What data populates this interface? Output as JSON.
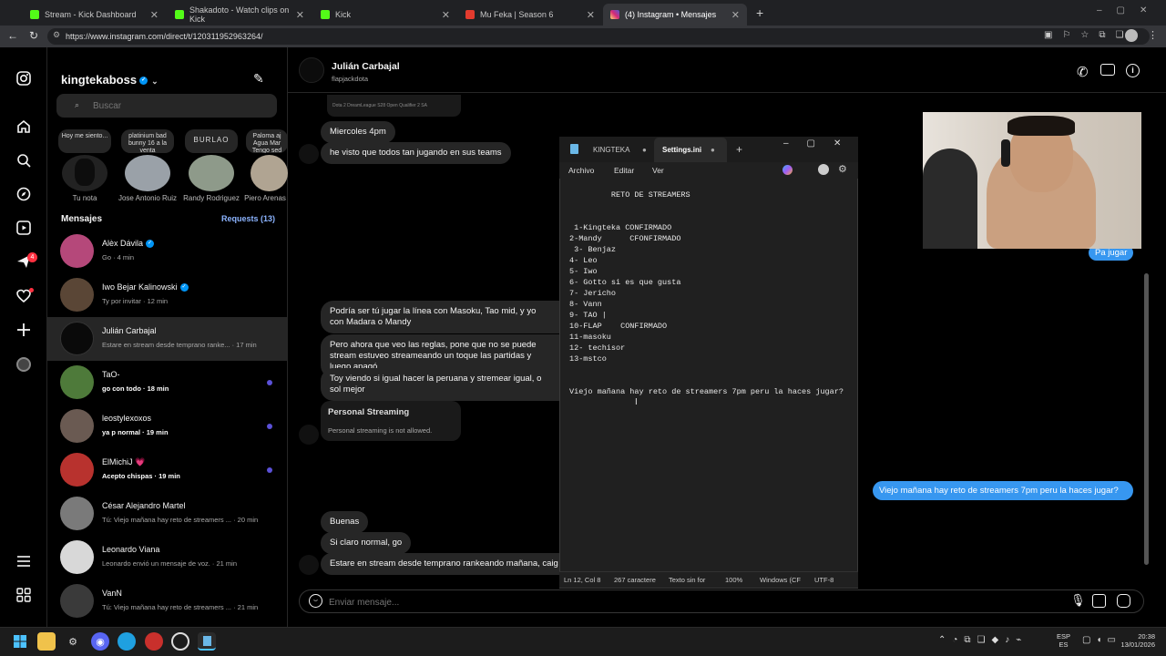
{
  "browser": {
    "tabs": [
      {
        "title": "Stream - Kick Dashboard",
        "color": "#53fc18",
        "active": false
      },
      {
        "title": "Shakadoto - Watch clips on Kick",
        "color": "#53fc18",
        "active": false
      },
      {
        "title": "Kick",
        "color": "#53fc18",
        "active": false
      },
      {
        "title": "Mu Feka | Season 6",
        "color": "#e33b2e",
        "active": false
      },
      {
        "title": "(4) Instagram • Mensajes",
        "color": "#e1306c",
        "active": true
      }
    ],
    "new_tab": "+",
    "url": "https://www.instagram.com/direct/t/120311952963264/"
  },
  "sidebar": {
    "icons": [
      "instagram-icon",
      "home-icon",
      "search-icon",
      "explore-icon",
      "reels-icon",
      "messages-icon",
      "notifications-icon",
      "create-icon",
      "profile-icon",
      "menu-icon",
      "apps-icon"
    ],
    "messages_badge": "4"
  },
  "inbox": {
    "username": "kingtekaboss",
    "search_placeholder": "Buscar",
    "notes": [
      {
        "bubble": "Hoy me siento...",
        "name": "Tu nota"
      },
      {
        "bubble": "platinium bad bunny 16 a la venta",
        "name": "Jose Antonio Ruiz"
      },
      {
        "bubble": "BURLAO",
        "name": "Randy Rodriguez"
      },
      {
        "bubble": "Paloma aj Agua Mar Tengo sed cs",
        "name": "Piero Arenas"
      }
    ],
    "messages_label": "Mensajes",
    "requests_label": "Requests (13)",
    "conversations": [
      {
        "name": "Alèx Dávila",
        "preview": "Go · 4 min",
        "verified": true,
        "unread": false,
        "bold": false,
        "avatar": "#b5487a"
      },
      {
        "name": "Iwo Bejar Kalinowski",
        "preview": "Ty por invitar · 12 min",
        "verified": true,
        "unread": false,
        "bold": false,
        "avatar": "#5a4636"
      },
      {
        "name": "Julián Carbajal",
        "preview": "Estare en stream desde temprano ranke... · 17 min",
        "verified": false,
        "unread": false,
        "bold": false,
        "avatar": "#0a0a0a",
        "selected": true
      },
      {
        "name": "TaO-",
        "preview": "go con todo · 18 min",
        "verified": false,
        "unread": true,
        "bold": true,
        "avatar": "#4e7a3a"
      },
      {
        "name": "leostylexoxos",
        "preview": "ya p normal · 19 min",
        "verified": false,
        "unread": true,
        "bold": true,
        "avatar": "#6a5a52"
      },
      {
        "name": "ElMichiJ",
        "preview": "Acepto chispas · 19 min",
        "verified": false,
        "unread": true,
        "bold": true,
        "avatar": "#b8322e",
        "heart": "💗"
      },
      {
        "name": "César Alejandro Martel",
        "preview": "Tú: Viejo mañana hay reto de streamers ... · 20 min",
        "verified": false,
        "unread": false,
        "bold": false,
        "avatar": "#7a7a7a"
      },
      {
        "name": "Leonardo Viana",
        "preview": "Leonardo envió un mensaje de voz. · 21 min",
        "verified": false,
        "unread": false,
        "bold": false,
        "avatar": "#d8d8d8"
      },
      {
        "name": "VanN",
        "preview": "Tú: Viejo mañana hay reto de streamers ... · 21 min",
        "verified": false,
        "unread": false,
        "bold": false,
        "avatar": "#3a3a3a"
      }
    ]
  },
  "chat": {
    "contact_name": "Julián Carbajal",
    "contact_handle": "flapjackdota",
    "shared_post_text": "Dota 2 DreamLeague S28 Open Qualifier 2 SA",
    "messages": {
      "m1": "Miercoles 4pm",
      "m2": "he visto que todos tan jugando en sus teams",
      "m3": "Podría ser tú jugar la línea con Masoku, Tao mid, y yo con Madara o Mandy",
      "m4": "Pero ahora que veo las reglas, pone que no se puede stream estuveo streameando un toque las partidas y luego apagó",
      "m5": "Toy viendo si igual hacer la peruana y stremear igual, o sol mejor",
      "m6": "Buenas",
      "m7": "Si claro normal, go",
      "m8": "Estare en stream desde temprano rankeando mañana, caig"
    },
    "card_title": "Personal Streaming",
    "card_text": "Personal streaming is not allowed.",
    "sent_1": "Pa jugar",
    "sent_2": "Viejo mañana hay reto de streamers 7pm peru la haces jugar?",
    "input_placeholder": "Enviar mensaje..."
  },
  "notepad": {
    "tab1": "KINGTEKA",
    "tab2": "Settings.ini",
    "menu": [
      "Archivo",
      "Editar",
      "Ver"
    ],
    "content": "         RETO DE STREAMERS\n\n\n 1-Kingteka CONFIRMADO\n2-Mandy      CFONFIRMADO\n 3- Benjaz\n4- Leo\n5- Iwo\n6- Gotto si es que gusta\n7- Jericho\n8- Vann\n9- TAO |\n10-FLAP    CONFIRMADO\n11-masoku\n12- techisor\n13-mstco\n\n\nViejo mañana hay reto de streamers 7pm peru la haces jugar?",
    "status": {
      "position": "Ln 12, Col 8",
      "chars": "267 caractere",
      "format": "Texto sin for",
      "zoom": "100%",
      "eol": "Windows (CF",
      "encoding": "UTF-8"
    }
  },
  "taskbar": {
    "lang": "ESP",
    "lang2": "ES",
    "time": "20:38",
    "date": "13/01/2026"
  }
}
